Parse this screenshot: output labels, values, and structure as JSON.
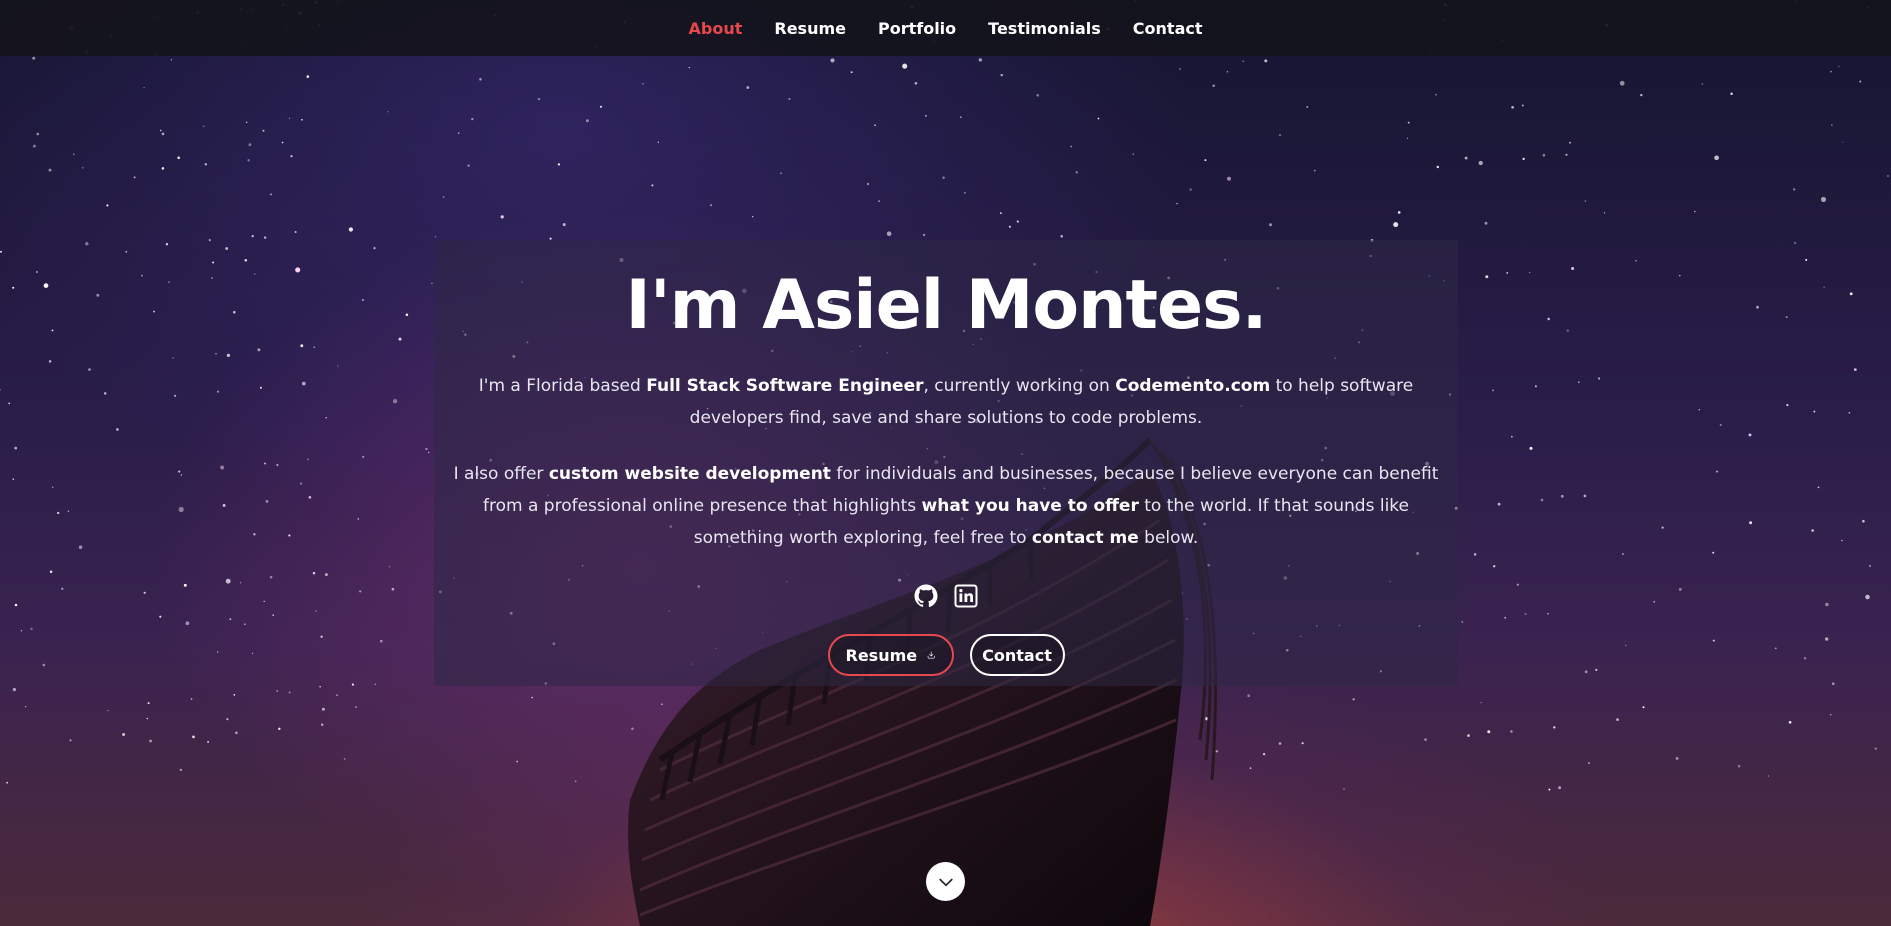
{
  "nav": {
    "items": [
      {
        "label": "About",
        "active": true
      },
      {
        "label": "Resume",
        "active": false
      },
      {
        "label": "Portfolio",
        "active": false
      },
      {
        "label": "Testimonials",
        "active": false
      },
      {
        "label": "Contact",
        "active": false
      }
    ]
  },
  "hero": {
    "title": "I'm Asiel Montes.",
    "intro": {
      "t1": "I'm a Florida based ",
      "b1": "Full Stack Software Engineer",
      "t2": ", currently working on ",
      "b2": "Codemento.com",
      "t3": " to help software developers find, save and share solutions to code problems."
    },
    "offer": {
      "t1": "I also offer ",
      "b1": "custom website development",
      "t2": " for individuals and businesses, because I believe everyone can benefit from a professional online presence that highlights ",
      "b2": "what you have to offer",
      "t3": " to the world. If that sounds like something worth exploring, feel free to ",
      "b3": "contact me",
      "t4": " below."
    },
    "socials": [
      {
        "icon": "github-icon"
      },
      {
        "icon": "linkedin-icon"
      }
    ],
    "buttons": {
      "resume_label": "Resume",
      "contact_label": "Contact"
    }
  },
  "colors": {
    "accent": "#e5484d",
    "nav_bg": "#14141c",
    "text": "#ffffff"
  },
  "icons": {
    "download": "download-icon",
    "scroll": "chevron-down-icon"
  }
}
